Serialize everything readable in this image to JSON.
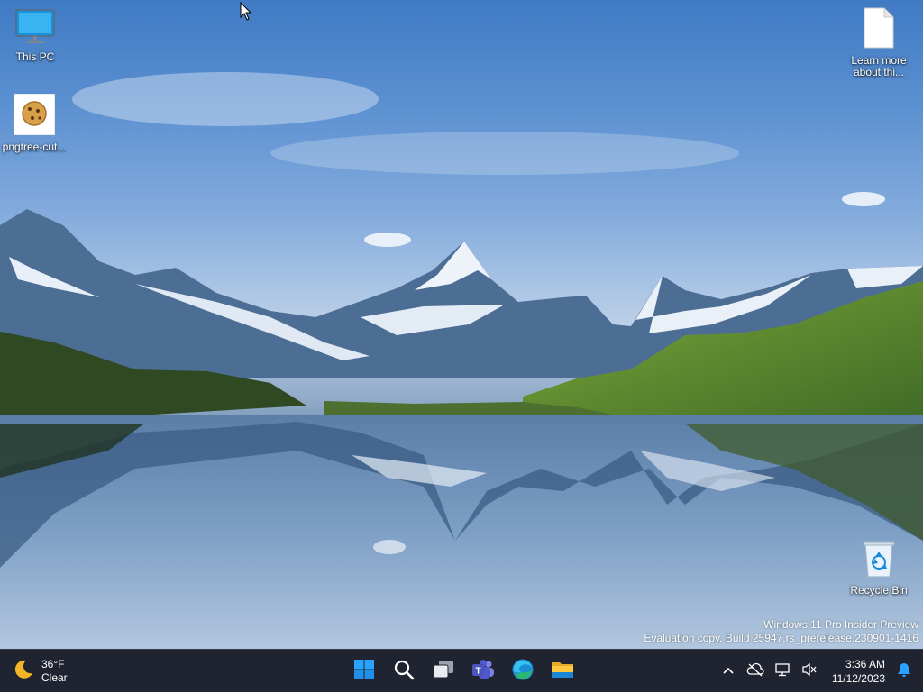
{
  "desktop": {
    "icons": [
      {
        "label": "This PC",
        "icon": "monitor-icon"
      },
      {
        "label": "pngtree-cut...",
        "icon": "cookie-image-icon"
      },
      {
        "label": "Learn more\nabout thi...",
        "icon": "document-icon"
      },
      {
        "label": "Recycle Bin",
        "icon": "recycle-bin-icon"
      }
    ],
    "watermark": {
      "line1": "Windows 11 Pro Insider Preview",
      "line2": "Evaluation copy. Build 25947.rs_prerelease.230901-1416"
    }
  },
  "taskbar": {
    "weather": {
      "temperature": "36°F",
      "condition": "Clear",
      "icon": "moon-icon"
    },
    "apps": [
      {
        "name": "Start",
        "icon": "windows-logo-icon"
      },
      {
        "name": "Search",
        "icon": "search-icon"
      },
      {
        "name": "Task View",
        "icon": "task-view-icon"
      },
      {
        "name": "Teams",
        "icon": "teams-icon"
      },
      {
        "name": "Edge",
        "icon": "edge-icon"
      },
      {
        "name": "File Explorer",
        "icon": "file-explorer-icon"
      }
    ],
    "tray": {
      "time": "3:36 AM",
      "date": "11/12/2023",
      "icons": [
        "chevron-up-icon",
        "onedrive-offline-icon",
        "network-icon",
        "volume-muted-icon",
        "notification-bell-icon"
      ]
    }
  },
  "colors": {
    "taskbar": "#1f2430",
    "accent": "#2aa3ff"
  }
}
